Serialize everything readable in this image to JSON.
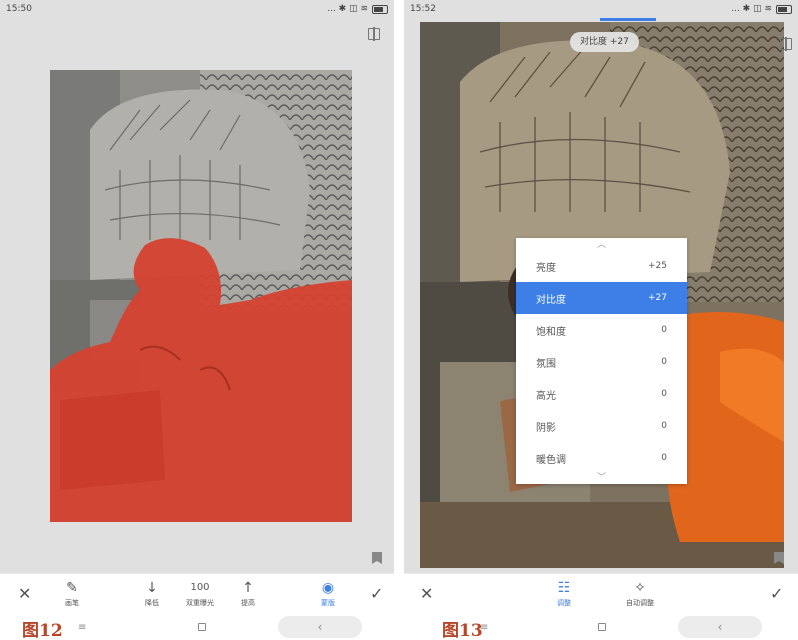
{
  "left": {
    "status_time": "15:50",
    "status_icons": "... ✱ ◫ ≋",
    "toolbar": {
      "close": "✕",
      "apply": "✓",
      "tools": [
        {
          "icon": "brush-icon",
          "glyph": "✎",
          "label": "画笔",
          "value": ""
        },
        {
          "icon": "arrow-down-icon",
          "glyph": "↓",
          "label": "降低",
          "value": ""
        },
        {
          "icon": "",
          "glyph": "",
          "label": "双重曝光",
          "value": "100"
        },
        {
          "icon": "arrow-up-icon",
          "glyph": "↑",
          "label": "提高",
          "value": ""
        },
        {
          "icon": "eye-icon",
          "glyph": "◉",
          "label": "蒙版",
          "value": ""
        }
      ]
    },
    "caption": "图12"
  },
  "right": {
    "status_time": "15:52",
    "status_icons": "... ✱ ◫ ≋",
    "toast": "对比度 +27",
    "menu": [
      {
        "label": "亮度",
        "value": "+25"
      },
      {
        "label": "对比度",
        "value": "+27"
      },
      {
        "label": "饱和度",
        "value": "0"
      },
      {
        "label": "氛围",
        "value": "0"
      },
      {
        "label": "高光",
        "value": "0"
      },
      {
        "label": "阴影",
        "value": "0"
      },
      {
        "label": "暖色调",
        "value": "0"
      }
    ],
    "toolbar": {
      "close": "✕",
      "apply": "✓",
      "tools": [
        {
          "icon": "sliders-icon",
          "glyph": "☷",
          "label": "调整"
        },
        {
          "icon": "magic-wand-icon",
          "glyph": "✧",
          "label": "自动调整"
        }
      ]
    },
    "caption": "图13"
  },
  "nav": {
    "menu": "≡",
    "back": "‹"
  },
  "colors": {
    "accent": "#3d7fe6",
    "mask_overlay": "#d4412f",
    "caption": "#b5462a"
  }
}
